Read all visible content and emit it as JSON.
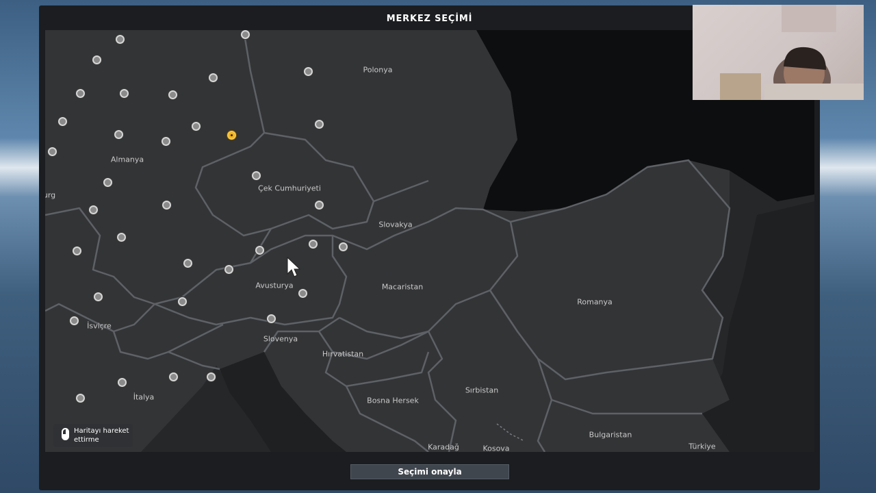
{
  "window": {
    "title": "MERKEZ SEÇİMİ"
  },
  "map": {
    "countries": [
      {
        "name": "Polonya"
      },
      {
        "name": "Almanya"
      },
      {
        "name": "Çek Cumhuriyeti"
      },
      {
        "name": "Slovakya"
      },
      {
        "name": "Avusturya"
      },
      {
        "name": "Macaristan"
      },
      {
        "name": "Romanya"
      },
      {
        "name": "İsviçre"
      },
      {
        "name": "Slovenya"
      },
      {
        "name": "Hırvatistan"
      },
      {
        "name": "İtalya"
      },
      {
        "name": "Bosna Hersek"
      },
      {
        "name": "Sırbistan"
      },
      {
        "name": "Bulgaristan"
      },
      {
        "name": "Karadağ"
      },
      {
        "name": "Kosova"
      },
      {
        "name": "Türkiye"
      },
      {
        "name": "urg"
      }
    ],
    "selected_city_index": 13
  },
  "hint": {
    "label": "Haritayı hareket ettirme",
    "icon": "mouse-icon"
  },
  "actions": {
    "confirm_label": "Seçimi onayla"
  },
  "colors": {
    "selected_marker": "#f0b323",
    "land": "#333436",
    "sea": "#262729",
    "border": "#5e6166"
  }
}
